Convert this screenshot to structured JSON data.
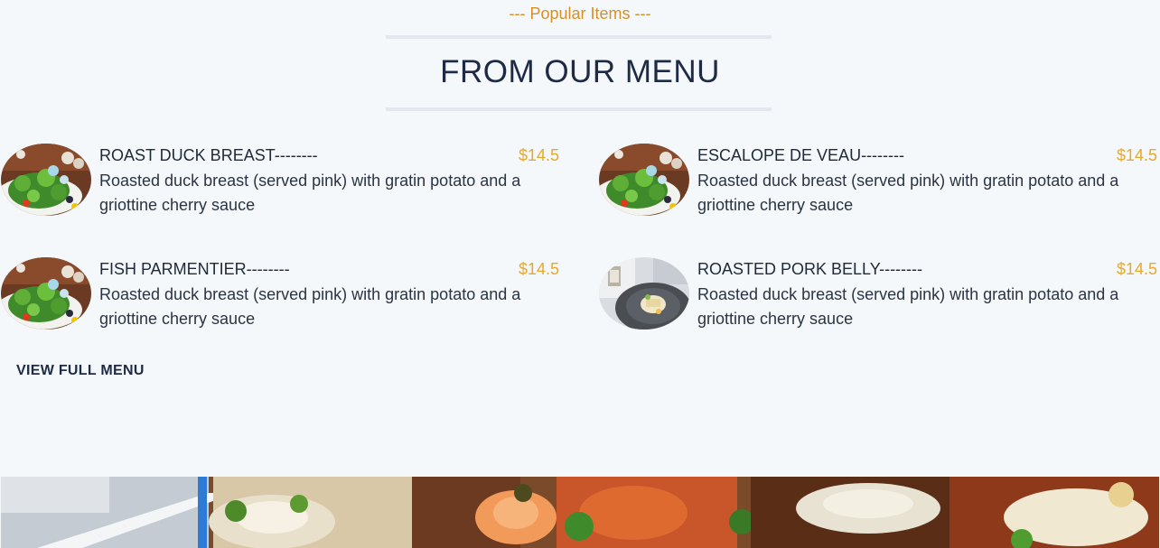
{
  "section": {
    "subtitle": "--- Popular Items ---",
    "title": "FROM OUR MENU"
  },
  "menu": {
    "items": [
      {
        "name": "ROAST DUCK BREAST--------",
        "price": "$14.5",
        "description": "Roasted duck breast (served pink) with gratin potato and a griottine cherry sauce",
        "image": "salad-plate"
      },
      {
        "name": "ESCALOPE DE VEAU--------",
        "price": "$14.5",
        "description": "Roasted duck breast (served pink) with gratin potato and a griottine cherry sauce",
        "image": "salad-plate"
      },
      {
        "name": "FISH PARMENTIER--------",
        "price": "$14.5",
        "description": "Roasted duck breast (served pink) with gratin potato and a griottine cherry sauce",
        "image": "salad-plate"
      },
      {
        "name": "ROASTED PORK BELLY--------",
        "price": "$14.5",
        "description": "Roasted duck breast (served pink) with gratin potato and a griottine cherry sauce",
        "image": "pork-belly-plate"
      }
    ],
    "view_full_label": "VIEW FULL MENU"
  },
  "colors": {
    "accent_subtitle": "#d4902a",
    "price": "#e5a92b",
    "background": "#f4f8fb",
    "heading": "#1f2a44"
  }
}
